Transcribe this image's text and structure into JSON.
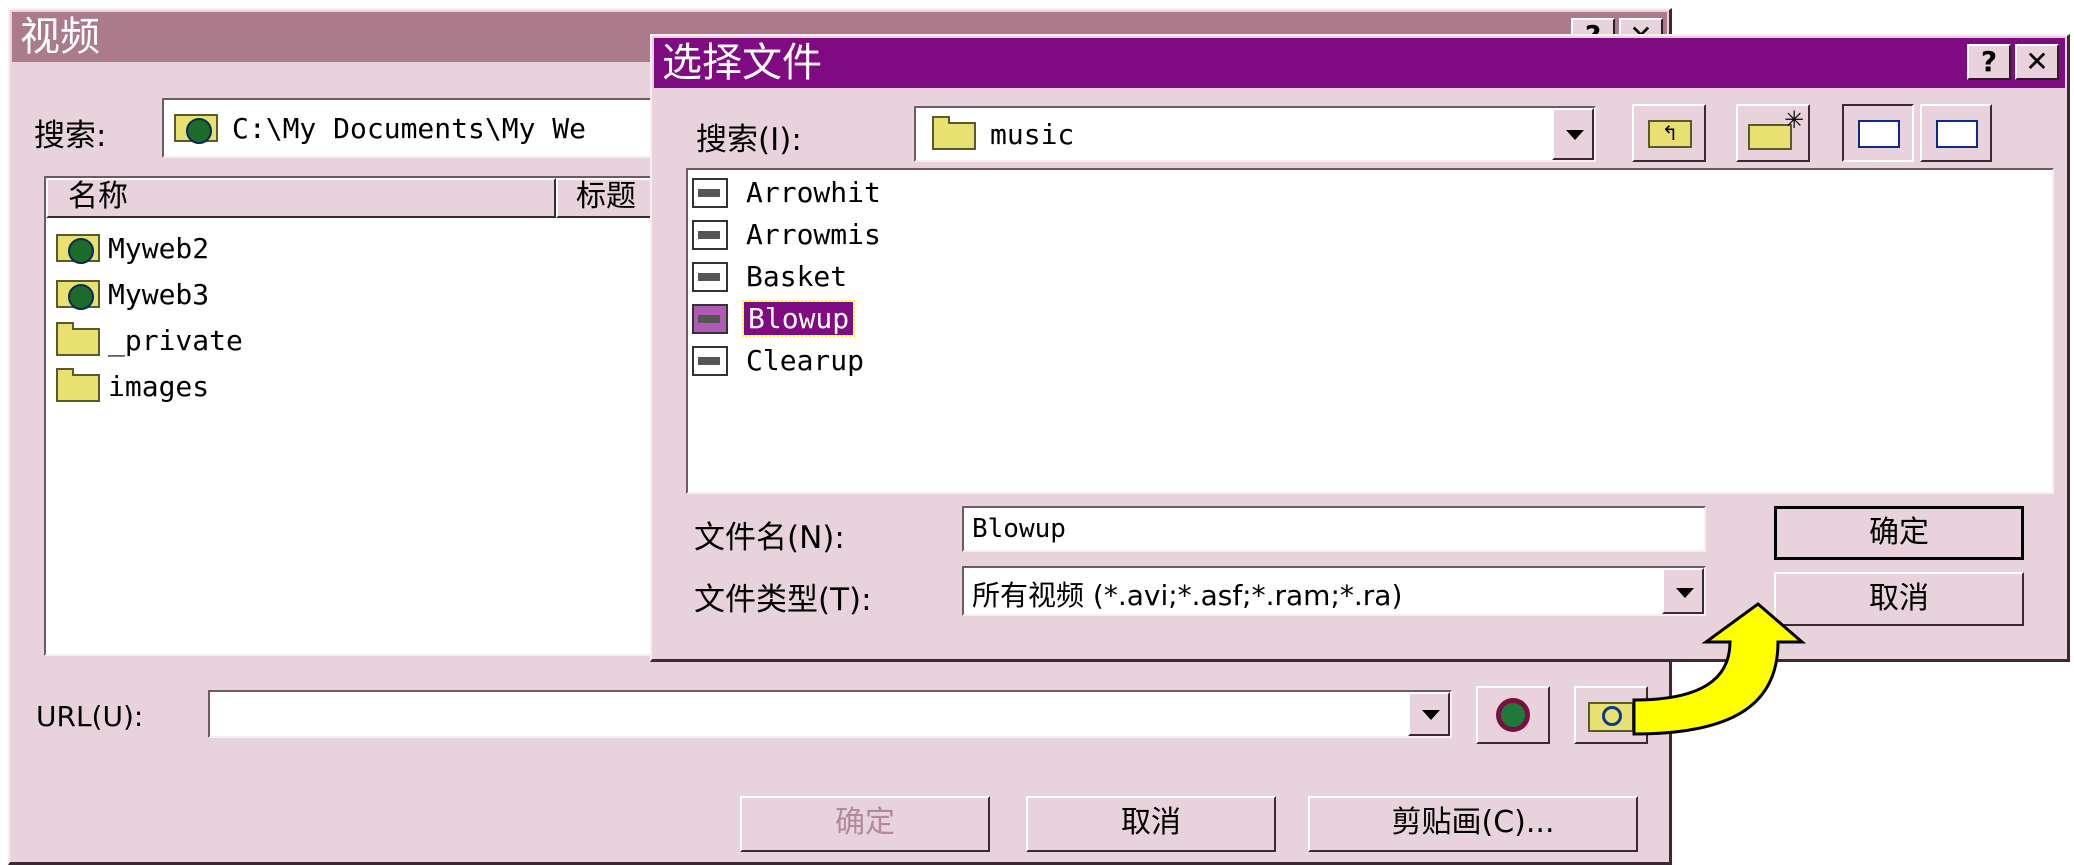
{
  "video_dialog": {
    "title": "视频",
    "help_btn": "?",
    "close_btn": "✕",
    "search_label": "搜索:",
    "path": "C:\\My Documents\\My We",
    "columns": [
      "名称",
      "标题"
    ],
    "items": [
      {
        "name": "Myweb2",
        "icon": "web-folder-icon"
      },
      {
        "name": "Myweb3",
        "icon": "web-folder-icon"
      },
      {
        "name": "_private",
        "icon": "folder-icon"
      },
      {
        "name": "images",
        "icon": "folder-icon"
      }
    ],
    "url_label": "URL(U):",
    "url_value": "",
    "ok_label": "确定",
    "cancel_label": "取消",
    "clipart_label": "剪贴画(C)..."
  },
  "file_dialog": {
    "title": "选择文件",
    "help_btn": "?",
    "close_btn": "✕",
    "search_label": "搜索(I):",
    "location": "music",
    "files": [
      {
        "name": "Arrowhit"
      },
      {
        "name": "Arrowmis"
      },
      {
        "name": "Basket"
      },
      {
        "name": "Blowup"
      },
      {
        "name": "Clearup"
      }
    ],
    "selected_file": "Blowup",
    "filename_label": "文件名(N):",
    "filename_value": "Blowup",
    "filetype_label": "文件类型(T):",
    "filetype_value": "所有视频 (*.avi;*.asf;*.ram;*.ra)",
    "ok_label": "确定",
    "cancel_label": "取消"
  },
  "colors": {
    "dialog_bg": "#e8d3dd",
    "video_title_bg": "#ab7b8b",
    "file_title_bg": "#800a82",
    "selection_bg": "#800a82",
    "arrow_fill": "#ffff00"
  }
}
